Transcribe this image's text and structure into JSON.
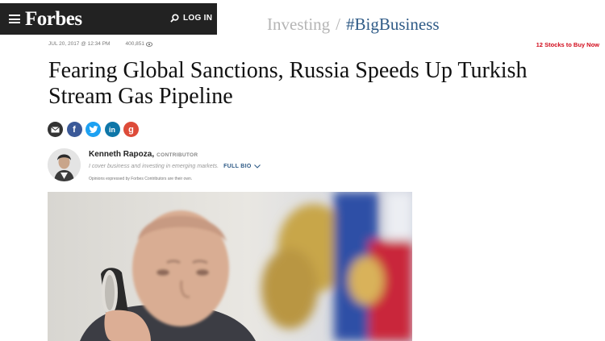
{
  "header": {
    "logo": "Forbes",
    "login_label": "LOG IN"
  },
  "channel": {
    "section": "Investing",
    "separator": "/",
    "tag": "#BigBusiness"
  },
  "meta": {
    "date": "JUL 20, 2017 @ 12:34 PM",
    "views": "400,851"
  },
  "promo": "12 Stocks to Buy Now",
  "article": {
    "headline": "Fearing Global Sanctions, Russia Speeds Up Turkish Stream Gas Pipeline"
  },
  "share": {
    "facebook_glyph": "f",
    "linkedin_glyph": "in",
    "google_glyph": "g"
  },
  "author": {
    "name": "Kenneth Rapoza,",
    "role": "CONTRIBUTOR",
    "description": "I cover business and investing in emerging markets.",
    "full_bio_label": "FULL BIO",
    "disclaimer": "Opinions expressed by Forbes Contributors are their own."
  },
  "colors": {
    "topbar": "#222222",
    "tag_blue": "#2e5a86",
    "promo_red": "#d10a1a",
    "email": "#333333",
    "facebook": "#3b5998",
    "twitter": "#1da1f2",
    "linkedin": "#0e76a8",
    "google": "#dd4b39"
  },
  "icons": [
    "menu-icon",
    "search-icon",
    "eye-icon",
    "email-icon",
    "facebook-icon",
    "twitter-icon",
    "linkedin-icon",
    "google-plus-icon",
    "chevron-down-icon"
  ]
}
